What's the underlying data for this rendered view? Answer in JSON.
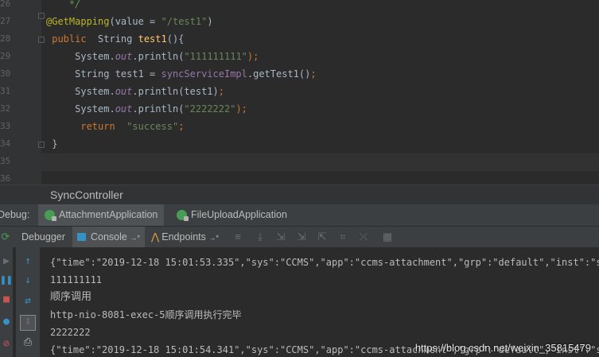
{
  "editor": {
    "line_numbers": [
      "26",
      "27",
      "28",
      "29",
      "30",
      "31",
      "32",
      "33",
      "34",
      "35",
      "36"
    ],
    "lines": [
      [
        {
          "t": "    */",
          "c": "cm"
        }
      ],
      [
        {
          "t": "@GetMapping",
          "c": "an"
        },
        {
          "t": "(value = ",
          "c": ""
        },
        {
          "t": "\"/test1\"",
          "c": "str"
        },
        {
          "t": ")",
          "c": ""
        }
      ],
      [
        {
          "t": " public",
          "c": "kw"
        },
        {
          "t": "  String ",
          "c": ""
        },
        {
          "t": "test1",
          "c": "fn"
        },
        {
          "t": "(){",
          "c": ""
        }
      ],
      [
        {
          "t": "     System.",
          "c": ""
        },
        {
          "t": "out",
          "c": "fld"
        },
        {
          "t": ".println(",
          "c": ""
        },
        {
          "t": "\"111111111\"",
          "c": "str"
        },
        {
          "t": ");",
          "c": "kw"
        }
      ],
      [
        {
          "t": "     String test1 = ",
          "c": ""
        },
        {
          "t": "syncServiceImpl",
          "c": "mv"
        },
        {
          "t": ".getTest1()",
          "c": ""
        },
        {
          "t": ";",
          "c": "kw"
        }
      ],
      [
        {
          "t": "     System.",
          "c": ""
        },
        {
          "t": "out",
          "c": "fld"
        },
        {
          "t": ".println(test1)",
          "c": ""
        },
        {
          "t": ";",
          "c": "kw"
        }
      ],
      [
        {
          "t": "     System.",
          "c": ""
        },
        {
          "t": "out",
          "c": "fld"
        },
        {
          "t": ".println(",
          "c": ""
        },
        {
          "t": "\"2222222\"",
          "c": "str"
        },
        {
          "t": ");",
          "c": "kw"
        }
      ],
      [
        {
          "t": "      return",
          "c": "kw"
        },
        {
          "t": "  ",
          "c": ""
        },
        {
          "t": "\"success\"",
          "c": "str"
        },
        {
          "t": ";",
          "c": "kw"
        }
      ],
      [
        {
          "t": " }",
          "c": ""
        }
      ],
      [
        {
          "t": "",
          "c": ""
        }
      ],
      [
        {
          "t": "",
          "c": ""
        }
      ]
    ]
  },
  "breadcrumb": "SyncController",
  "debug_bar": {
    "label": "Debug:",
    "tabs": [
      "AttachmentApplication",
      "FileUploadApplication"
    ]
  },
  "toolbar": {
    "debugger": "Debugger",
    "console": "Console",
    "console_arrow": "→*",
    "endpoints": "Endpoints",
    "endpoints_arrow": "→*"
  },
  "console": {
    "lines": [
      "{\"time\":\"2019-12-18 15:01:53.335\",\"sys\":\"CCMS\",\"app\":\"ccms-attachment\",\"grp\":\"default\",\"inst\":\"sc:c",
      "111111111",
      "顺序调用",
      "http-nio-8081-exec-5顺序调用执行完毕",
      "2222222",
      "{\"time\":\"2019-12-18 15:01:54.341\",\"sys\":\"CCMS\",\"app\":\"ccms-attachment\",\"grp\":\"default\",\"inst\":\"sc:c"
    ]
  },
  "watermark": "https://blog.csdn.net/weixin_35815479",
  "colors": {
    "keyword": "#cc7832",
    "annotation": "#bbb529",
    "string": "#6a8759",
    "field": "#9876aa",
    "method": "#ffc66d"
  }
}
